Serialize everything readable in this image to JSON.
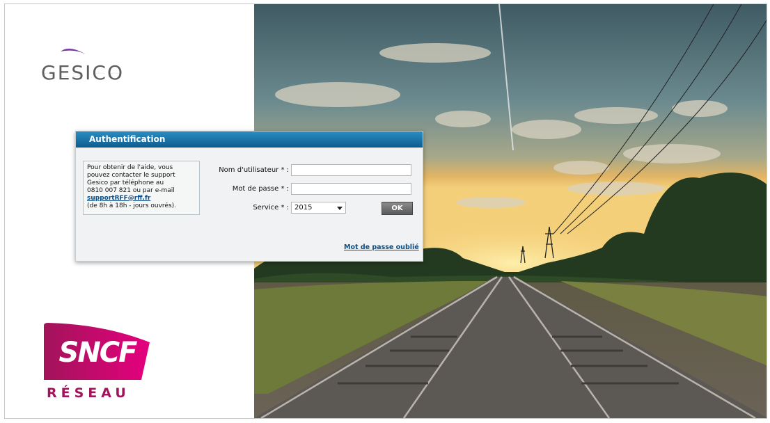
{
  "brand": {
    "app_name": "GESICO",
    "company_badge": "SNCF",
    "company_sub": "RÉSEAU",
    "colors": {
      "sncf_gradient_start": "#a2145a",
      "sncf_gradient_end": "#e5007e",
      "header_blue": "#1a75aa",
      "link_blue": "#0b4d86"
    }
  },
  "auth": {
    "title": "Authentification",
    "help": {
      "line1": "Pour obtenir de l'aide, vous",
      "line2": "pouvez contacter le support",
      "line3": "Gesico par téléphone au",
      "line4": "0810 007 821 ou par e-mail",
      "email": "supportRFF@rff.fr",
      "hours": "(de 8h à 18h - jours ouvrés)."
    },
    "fields": {
      "username_label": "Nom d'utilisateur * :",
      "username_value": "",
      "password_label": "Mot de passe * :",
      "password_value": "",
      "service_label": "Service * :",
      "service_value": "2015"
    },
    "ok_label": "OK",
    "forgot_label": "Mot de passe oublié"
  }
}
